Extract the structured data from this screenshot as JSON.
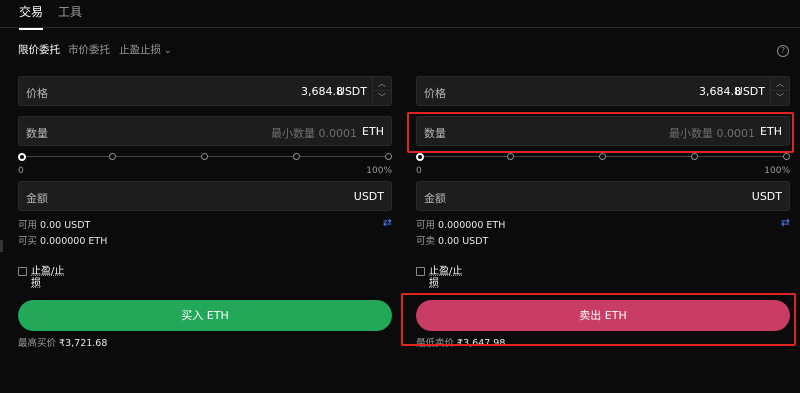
{
  "top_tabs": [
    "交易",
    "工具"
  ],
  "order_tabs": {
    "limit": "限价委托",
    "market": "市价委托",
    "tpsl": "止盈止损"
  },
  "help": "?",
  "buy": {
    "price_label": "价格",
    "price_value": "3,684.8",
    "price_unit": "USDT",
    "qty_label": "数量",
    "qty_placeholder": "最小数量 0.0001",
    "qty_unit": "ETH",
    "pct_min": "0",
    "pct_max": "100%",
    "amount_label": "金额",
    "amount_unit": "USDT",
    "avail_label": "可用",
    "avail_value": "0.00 USDT",
    "can_label": "可买",
    "can_value": "0.000000 ETH",
    "tpsl_label": "止盈/止损",
    "button": "买入 ETH",
    "best_label": "最高买价",
    "best_value": "₹3,721.68"
  },
  "sell": {
    "price_label": "价格",
    "price_value": "3,684.8",
    "price_unit": "USDT",
    "qty_label": "数量",
    "qty_placeholder": "最小数量 0.0001",
    "qty_unit": "ETH",
    "pct_min": "0",
    "pct_max": "100%",
    "amount_label": "金额",
    "amount_unit": "USDT",
    "avail_label": "可用",
    "avail_value": "0.000000 ETH",
    "can_label": "可卖",
    "can_value": "0.00 USDT",
    "tpsl_label": "止盈/止损",
    "button": "卖出 ETH",
    "best_label": "最低卖价",
    "best_value": "₹3,647.98"
  },
  "colors": {
    "buy": "#23a85a",
    "sell": "#c93d64",
    "highlight": "#e0241f",
    "swap_icon": "#4f7cff"
  }
}
